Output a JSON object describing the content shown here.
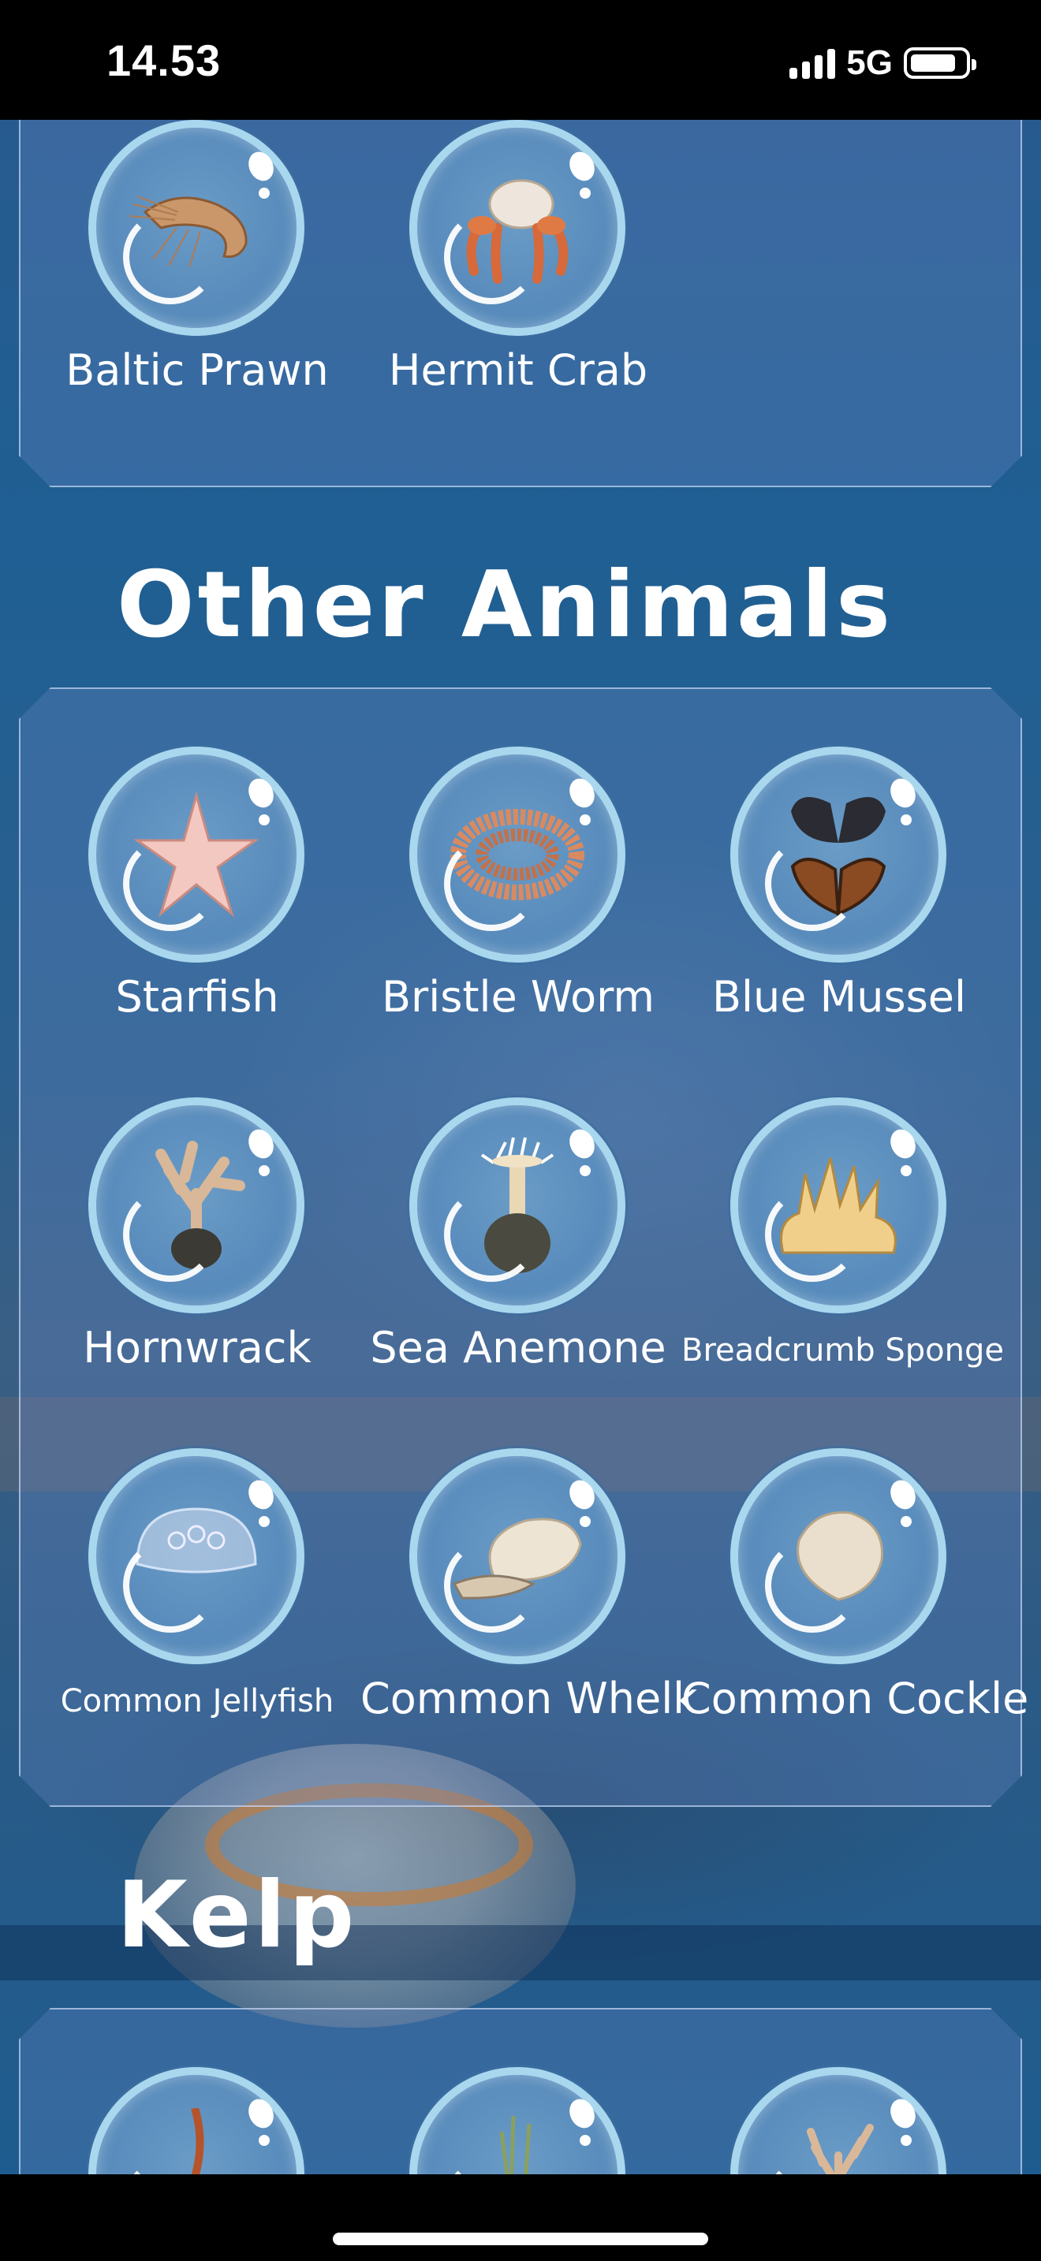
{
  "status_bar": {
    "time": "14.53",
    "network": "5G"
  },
  "sections": {
    "crustaceans_partial": {
      "items": [
        {
          "name": "Baltic Prawn",
          "icon": "prawn-icon"
        },
        {
          "name": "Hermit Crab",
          "icon": "hermit-crab-icon"
        }
      ]
    },
    "other_animals": {
      "title": "Other Animals",
      "items": [
        {
          "name": "Starfish",
          "icon": "starfish-icon"
        },
        {
          "name": "Bristle Worm",
          "icon": "bristle-worm-icon"
        },
        {
          "name": "Blue Mussel",
          "icon": "blue-mussel-icon"
        },
        {
          "name": "Hornwrack",
          "icon": "hornwrack-icon"
        },
        {
          "name": "Sea Anemone",
          "icon": "sea-anemone-icon"
        },
        {
          "name": "Breadcrumb Sponge",
          "icon": "sponge-icon"
        },
        {
          "name": "Common Jellyfish",
          "icon": "jellyfish-icon"
        },
        {
          "name": "Common Whelk",
          "icon": "whelk-icon"
        },
        {
          "name": "Common Cockle",
          "icon": "cockle-icon"
        }
      ]
    },
    "kelp": {
      "title": "Kelp",
      "items": [
        {
          "icon": "kelp-icon"
        },
        {
          "icon": "seagrass-icon"
        },
        {
          "icon": "coral-algae-icon"
        }
      ]
    }
  },
  "colors": {
    "bubble_rim": "#a9d7ee",
    "card_border": "#d2e1fa",
    "text": "#ffffff"
  }
}
